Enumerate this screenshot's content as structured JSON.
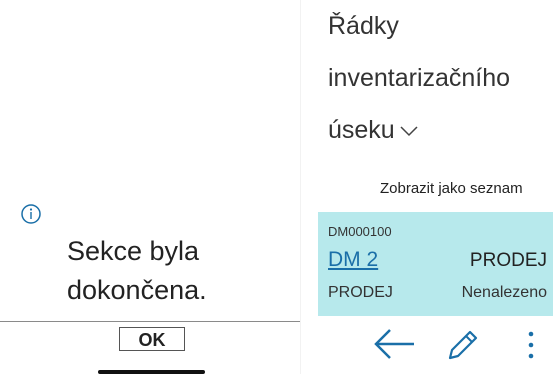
{
  "dialog": {
    "icon": "info-icon",
    "message": "Sekce byla dokončena.",
    "ok_label": "OK"
  },
  "page": {
    "title_lines": [
      "Řádky",
      "inventarizačního",
      "úseku"
    ],
    "show_as_list_label": "Zobrazit jako seznam",
    "record": {
      "document_no": "DM000100",
      "code": "DM 2",
      "type_primary": "PRODEJ",
      "type_secondary": "PRODEJ",
      "status": "Nenalezeno"
    },
    "actions": [
      "back-arrow-icon",
      "edit-pencil-icon",
      "more-vertical-icon"
    ]
  },
  "colors": {
    "accent": "#1a6fa8",
    "card_background": "#b7e9ec"
  }
}
